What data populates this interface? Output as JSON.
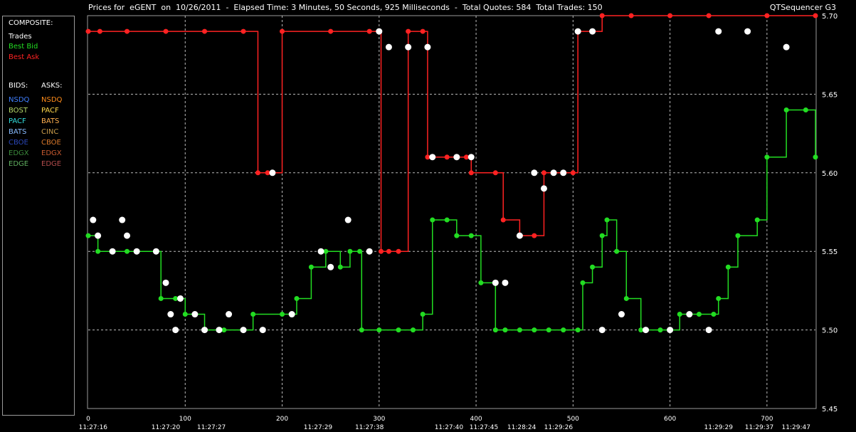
{
  "title": "Prices for  eGENT  on  10/26/2011  -  Elapsed Time: 3 Minutes, 50 Seconds, 925 Milliseconds  -  Total Quotes: 584  Total Trades: 150",
  "app_name": "QTSequencer G3",
  "legend": {
    "composite_header": "COMPOSITE:",
    "composite": [
      {
        "label": "Trades",
        "color": "#ffffff"
      },
      {
        "label": "Best Bid",
        "color": "#22dd22"
      },
      {
        "label": "Best Ask",
        "color": "#ff2222"
      }
    ],
    "bids_header": "BIDS:",
    "asks_header": "ASKS:",
    "bids": [
      {
        "label": "NSDQ",
        "color": "#3f7fff"
      },
      {
        "label": "BOST",
        "color": "#b6d96a"
      },
      {
        "label": "PACF",
        "color": "#33dddd"
      },
      {
        "label": "BATS",
        "color": "#88bbff"
      },
      {
        "label": "CBOE",
        "color": "#2a46b8"
      },
      {
        "label": "EDGX",
        "color": "#3b8a3b"
      },
      {
        "label": "EDGE",
        "color": "#5fae5f"
      }
    ],
    "asks": [
      {
        "label": "NSDQ",
        "color": "#ff8c1a"
      },
      {
        "label": "PACF",
        "color": "#ffd84a"
      },
      {
        "label": "BATS",
        "color": "#ffb050"
      },
      {
        "label": "CINC",
        "color": "#c79a4a"
      },
      {
        "label": "CBOE",
        "color": "#d9782b"
      },
      {
        "label": "EDGX",
        "color": "#c85a30"
      },
      {
        "label": "EDGE",
        "color": "#b24c4c"
      }
    ]
  },
  "chart_data": {
    "type": "line",
    "ylim": [
      5.45,
      5.7
    ],
    "xlim": [
      0,
      750
    ],
    "y_ticks": [
      5.45,
      5.5,
      5.55,
      5.6,
      5.65,
      5.7
    ],
    "x_ticks": [
      {
        "value": 0,
        "label": "0"
      },
      {
        "value": 100,
        "label": "100"
      },
      {
        "value": 200,
        "label": "200"
      },
      {
        "value": 300,
        "label": "300"
      },
      {
        "value": 400,
        "label": "400"
      },
      {
        "value": 500,
        "label": "500"
      },
      {
        "value": 600,
        "label": "600"
      },
      {
        "value": 700,
        "label": "700"
      }
    ],
    "time_labels": [
      {
        "x": 5,
        "label": "11:27:16"
      },
      {
        "x": 80,
        "label": "11:27:20"
      },
      {
        "x": 127,
        "label": "11:27:27"
      },
      {
        "x": 237,
        "label": "11:27:29"
      },
      {
        "x": 290,
        "label": "11:27:38"
      },
      {
        "x": 372,
        "label": "11:27:40"
      },
      {
        "x": 408,
        "label": "11:27:45"
      },
      {
        "x": 447,
        "label": "11:28:24"
      },
      {
        "x": 485,
        "label": "11:29:26"
      },
      {
        "x": 650,
        "label": "11:29:29"
      },
      {
        "x": 692,
        "label": "11:29:37"
      },
      {
        "x": 730,
        "label": "11:29:47"
      }
    ],
    "grid": true,
    "series": [
      {
        "name": "Best Ask",
        "color": "#ff2222",
        "points": [
          [
            0,
            5.69
          ],
          [
            12,
            5.69
          ],
          [
            40,
            5.69
          ],
          [
            80,
            5.69
          ],
          [
            120,
            5.69
          ],
          [
            160,
            5.69
          ],
          [
            175,
            5.6
          ],
          [
            185,
            5.6
          ],
          [
            200,
            5.69
          ],
          [
            250,
            5.69
          ],
          [
            290,
            5.69
          ],
          [
            300,
            5.69
          ],
          [
            302,
            5.55
          ],
          [
            310,
            5.55
          ],
          [
            320,
            5.55
          ],
          [
            330,
            5.69
          ],
          [
            345,
            5.69
          ],
          [
            350,
            5.61
          ],
          [
            370,
            5.61
          ],
          [
            390,
            5.61
          ],
          [
            395,
            5.6
          ],
          [
            420,
            5.6
          ],
          [
            428,
            5.57
          ],
          [
            445,
            5.56
          ],
          [
            460,
            5.56
          ],
          [
            470,
            5.6
          ],
          [
            500,
            5.6
          ],
          [
            505,
            5.69
          ],
          [
            520,
            5.69
          ],
          [
            530,
            5.7
          ],
          [
            560,
            5.7
          ],
          [
            600,
            5.7
          ],
          [
            640,
            5.7
          ],
          [
            700,
            5.7
          ],
          [
            750,
            5.7
          ]
        ]
      },
      {
        "name": "Best Bid",
        "color": "#22dd22",
        "points": [
          [
            0,
            5.56
          ],
          [
            10,
            5.55
          ],
          [
            40,
            5.55
          ],
          [
            70,
            5.55
          ],
          [
            75,
            5.52
          ],
          [
            90,
            5.52
          ],
          [
            100,
            5.51
          ],
          [
            110,
            5.51
          ],
          [
            120,
            5.5
          ],
          [
            140,
            5.5
          ],
          [
            160,
            5.5
          ],
          [
            170,
            5.51
          ],
          [
            200,
            5.51
          ],
          [
            215,
            5.52
          ],
          [
            230,
            5.54
          ],
          [
            245,
            5.55
          ],
          [
            260,
            5.54
          ],
          [
            270,
            5.55
          ],
          [
            280,
            5.55
          ],
          [
            282,
            5.5
          ],
          [
            300,
            5.5
          ],
          [
            320,
            5.5
          ],
          [
            335,
            5.5
          ],
          [
            345,
            5.51
          ],
          [
            355,
            5.57
          ],
          [
            370,
            5.57
          ],
          [
            380,
            5.56
          ],
          [
            395,
            5.56
          ],
          [
            405,
            5.53
          ],
          [
            420,
            5.5
          ],
          [
            430,
            5.5
          ],
          [
            445,
            5.5
          ],
          [
            460,
            5.5
          ],
          [
            475,
            5.5
          ],
          [
            490,
            5.5
          ],
          [
            505,
            5.5
          ],
          [
            510,
            5.53
          ],
          [
            520,
            5.54
          ],
          [
            530,
            5.56
          ],
          [
            535,
            5.57
          ],
          [
            545,
            5.55
          ],
          [
            555,
            5.52
          ],
          [
            570,
            5.5
          ],
          [
            590,
            5.5
          ],
          [
            610,
            5.51
          ],
          [
            630,
            5.51
          ],
          [
            645,
            5.51
          ],
          [
            650,
            5.52
          ],
          [
            660,
            5.54
          ],
          [
            670,
            5.56
          ],
          [
            690,
            5.57
          ],
          [
            700,
            5.61
          ],
          [
            720,
            5.64
          ],
          [
            740,
            5.64
          ],
          [
            750,
            5.61
          ]
        ]
      },
      {
        "name": "Trades",
        "color": "#ffffff",
        "points": [
          [
            5,
            5.57
          ],
          [
            10,
            5.56
          ],
          [
            25,
            5.55
          ],
          [
            35,
            5.57
          ],
          [
            40,
            5.56
          ],
          [
            50,
            5.55
          ],
          [
            70,
            5.55
          ],
          [
            80,
            5.53
          ],
          [
            85,
            5.51
          ],
          [
            90,
            5.5
          ],
          [
            95,
            5.52
          ],
          [
            110,
            5.51
          ],
          [
            120,
            5.5
          ],
          [
            135,
            5.5
          ],
          [
            145,
            5.51
          ],
          [
            160,
            5.5
          ],
          [
            180,
            5.5
          ],
          [
            190,
            5.6
          ],
          [
            210,
            5.51
          ],
          [
            240,
            5.55
          ],
          [
            250,
            5.54
          ],
          [
            268,
            5.57
          ],
          [
            290,
            5.55
          ],
          [
            300,
            5.69
          ],
          [
            310,
            5.68
          ],
          [
            330,
            5.68
          ],
          [
            350,
            5.68
          ],
          [
            355,
            5.61
          ],
          [
            380,
            5.61
          ],
          [
            395,
            5.61
          ],
          [
            420,
            5.53
          ],
          [
            430,
            5.53
          ],
          [
            445,
            5.56
          ],
          [
            460,
            5.6
          ],
          [
            470,
            5.59
          ],
          [
            480,
            5.6
          ],
          [
            490,
            5.6
          ],
          [
            505,
            5.69
          ],
          [
            520,
            5.69
          ],
          [
            530,
            5.5
          ],
          [
            550,
            5.51
          ],
          [
            575,
            5.5
          ],
          [
            600,
            5.5
          ],
          [
            620,
            5.51
          ],
          [
            640,
            5.5
          ],
          [
            650,
            5.69
          ],
          [
            680,
            5.69
          ],
          [
            720,
            5.68
          ]
        ]
      }
    ]
  }
}
